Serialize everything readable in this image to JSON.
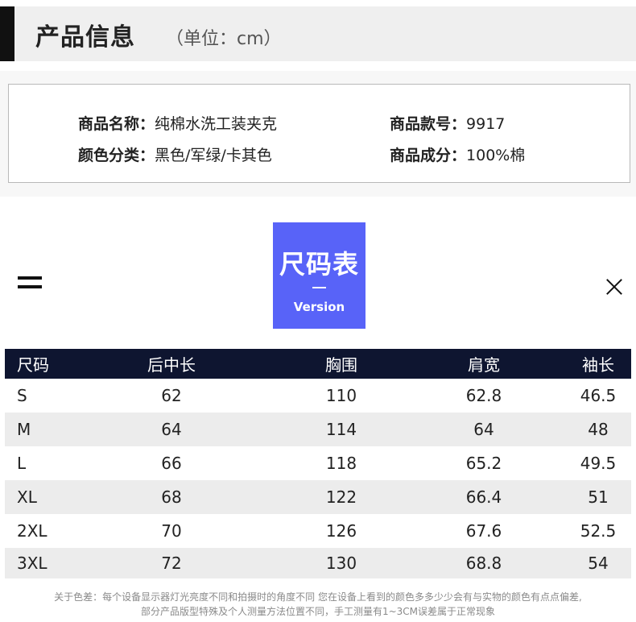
{
  "header": {
    "title": "产品信息",
    "unit": "（单位：cm）"
  },
  "info": {
    "name_label": "商品名称：",
    "name_value": "纯棉水洗工装夹克",
    "style_label": "商品款号：",
    "style_value": "9917",
    "color_label": "颜色分类：",
    "color_value": "黑色/军绿/卡其色",
    "material_label": "商品成分：",
    "material_value": "100%棉"
  },
  "badge": {
    "title": "尺码表",
    "subtitle": "Version"
  },
  "icons": {
    "menu": "menu-icon",
    "close": "close-icon"
  },
  "table": {
    "headers": [
      "尺码",
      "后中长",
      "胸围",
      "肩宽",
      "袖长"
    ],
    "rows": [
      [
        "S",
        "62",
        "110",
        "62.8",
        "46.5"
      ],
      [
        "M",
        "64",
        "114",
        "64",
        "48"
      ],
      [
        "L",
        "66",
        "118",
        "65.2",
        "49.5"
      ],
      [
        "XL",
        "68",
        "122",
        "66.4",
        "51"
      ],
      [
        "2XL",
        "70",
        "126",
        "67.6",
        "52.5"
      ],
      [
        "3XL",
        "72",
        "130",
        "68.8",
        "54"
      ]
    ]
  },
  "notes": {
    "line1": "关于色差：每个设备显示器灯光亮度不同和拍摄时的角度不同 您在设备上看到的颜色多多少少会有与实物的颜色有点点偏差,",
    "line2": "部分产品版型特殊及个人测量方法位置不同，手工测量有1~3CM误差属于正常现象"
  },
  "colors": {
    "badge": "#5863f8",
    "table_header": "#0e1530",
    "stripe": "#ececec",
    "header_bg": "#efefef"
  }
}
